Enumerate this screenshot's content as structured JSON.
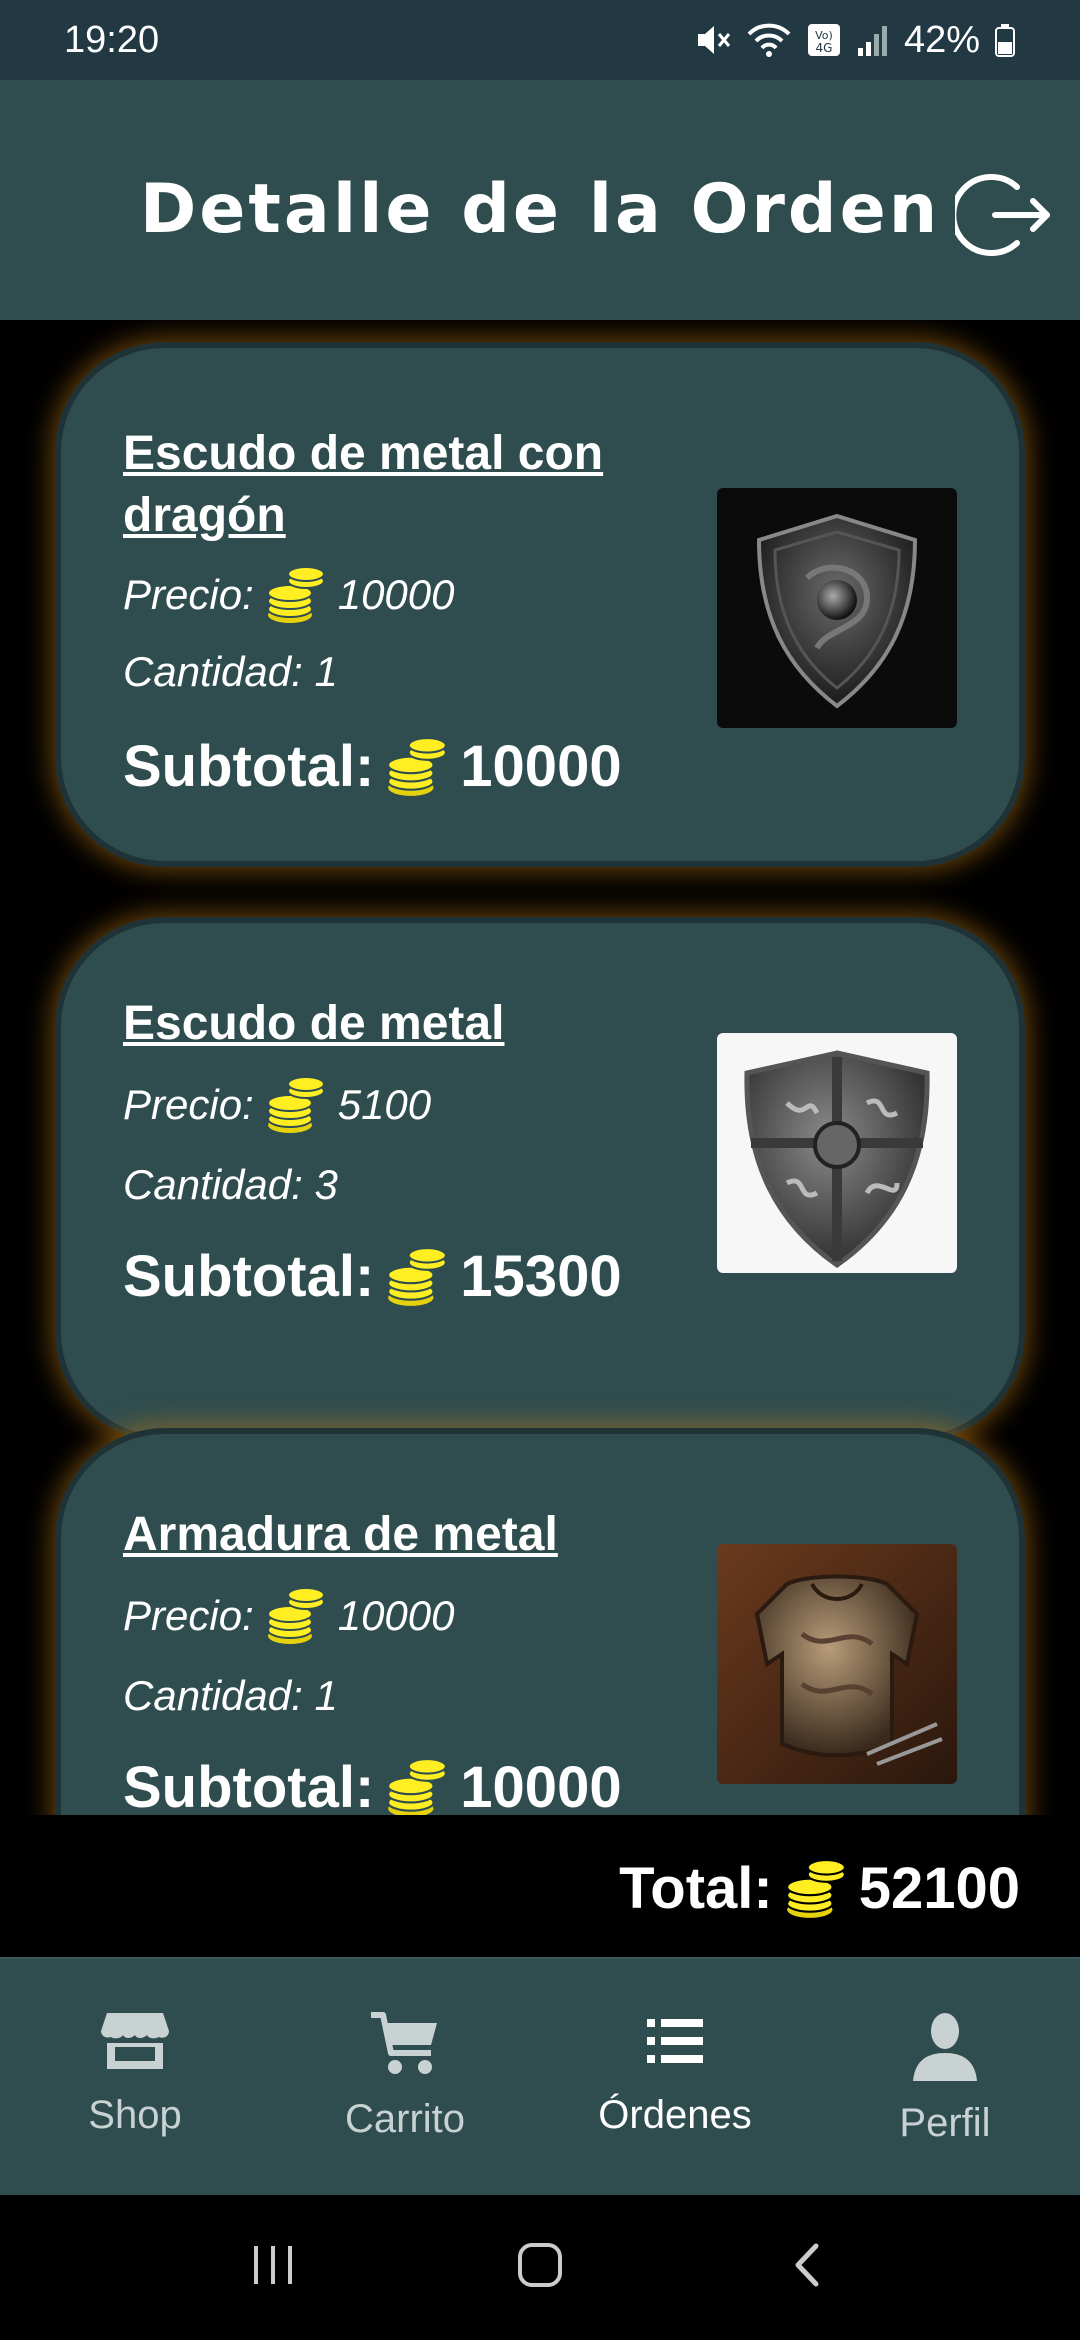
{
  "status_bar": {
    "time": "19:20",
    "battery": "42%",
    "icons": [
      "mute-icon",
      "wifi-icon",
      "volte-icon",
      "signal-icon",
      "battery-icon"
    ],
    "volte_label": "Vo) 4G"
  },
  "header": {
    "title": "Detalle de la Orden",
    "logout_icon": "logout-icon"
  },
  "colors": {
    "primary": "#2f4d4f",
    "status_bar": "#223843",
    "background": "#000000",
    "coin": "#ffee22",
    "glow": "#be7814"
  },
  "order_items": [
    {
      "name": "Escudo de metal con dragón",
      "price_label": "Precio:",
      "price": "10000",
      "quantity_label": "Cantidad: 1",
      "subtotal_label": "Subtotal:",
      "subtotal": "10000",
      "image": "dragon-shield-image"
    },
    {
      "name": "Escudo de metal",
      "price_label": "Precio:",
      "price": "5100",
      "quantity_label": "Cantidad: 3",
      "subtotal_label": "Subtotal:",
      "subtotal": "15300",
      "image": "metal-shield-image"
    },
    {
      "name": "Armadura de metal",
      "price_label": "Precio:",
      "price": "10000",
      "quantity_label": "Cantidad: 1",
      "subtotal_label": "Subtotal:",
      "subtotal": "10000",
      "image": "metal-armor-image"
    }
  ],
  "total": {
    "label": "Total:",
    "value": "52100"
  },
  "bottom_nav": {
    "items": [
      {
        "label": "Shop",
        "icon": "store-icon",
        "active": false
      },
      {
        "label": "Carrito",
        "icon": "cart-icon",
        "active": false
      },
      {
        "label": "Órdenes",
        "icon": "list-icon",
        "active": true
      },
      {
        "label": "Perfil",
        "icon": "person-icon",
        "active": false
      }
    ]
  },
  "system_nav": {
    "icons": [
      "recents-icon",
      "home-icon",
      "back-icon"
    ]
  }
}
